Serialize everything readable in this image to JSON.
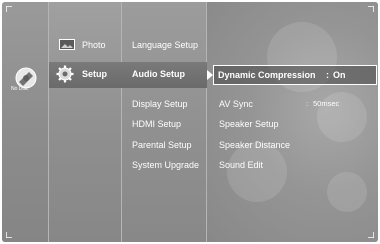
{
  "disc_status": {
    "label": "No Disc"
  },
  "main_menu": {
    "items": [
      {
        "label": "Photo",
        "icon": "photo-icon"
      },
      {
        "label": "Setup",
        "icon": "gear-icon",
        "selected": true
      }
    ]
  },
  "setup_menu": {
    "items": [
      {
        "label": "Language Setup"
      },
      {
        "label": "Audio Setup",
        "selected": true
      },
      {
        "label": "Display Setup"
      },
      {
        "label": "HDMI Setup"
      },
      {
        "label": "Parental Setup"
      },
      {
        "label": "System Upgrade"
      }
    ]
  },
  "audio_options": {
    "items": [
      {
        "label": "Dynamic Compression",
        "value": "On",
        "separator": ":",
        "selected": true
      },
      {
        "label": "AV Sync",
        "value": "50msec",
        "separator": ":"
      },
      {
        "label": "Speaker Setup"
      },
      {
        "label": "Speaker Distance"
      },
      {
        "label": "Sound Edit"
      }
    ]
  },
  "colors": {
    "highlight": "#707070",
    "text": "#ffffff",
    "background": "#8c8c8c"
  }
}
